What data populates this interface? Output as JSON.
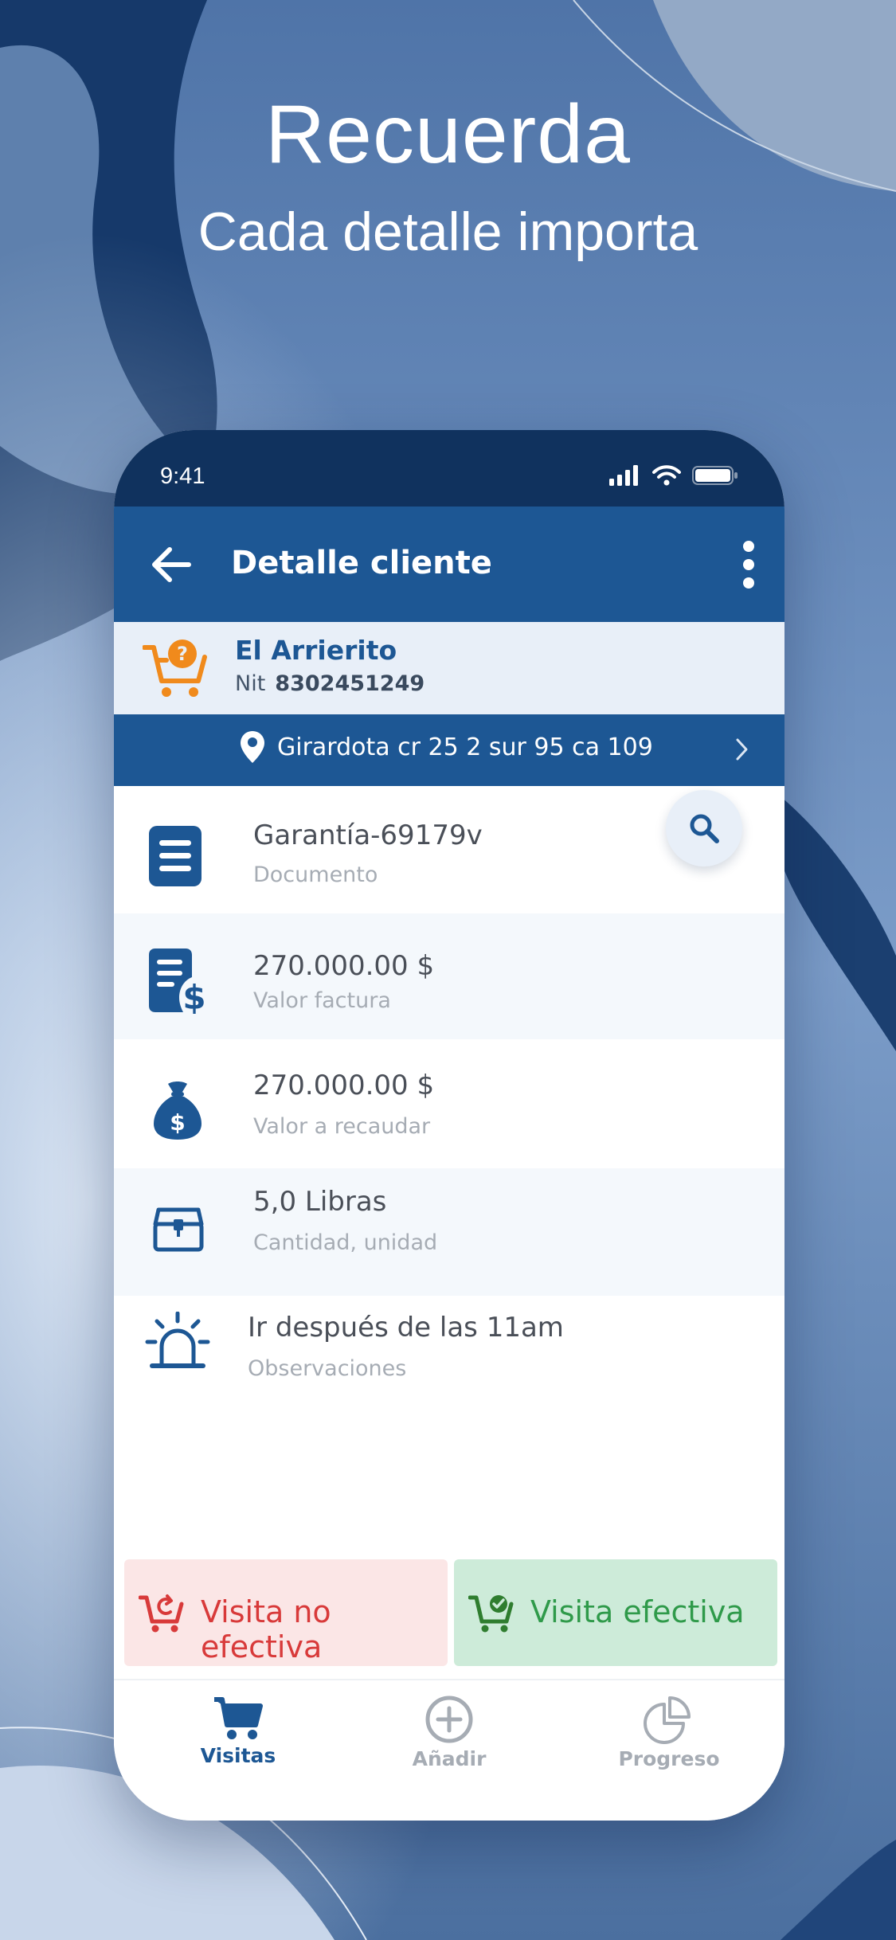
{
  "promo": {
    "headline": "Recuerda",
    "subheadline": "Cada detalle importa"
  },
  "status_bar": {
    "time": "9:41"
  },
  "app_bar": {
    "title": "Detalle cliente"
  },
  "client": {
    "name": "El Arrierito",
    "nit_label": "Nit",
    "nit_value": "8302451249"
  },
  "address": {
    "text": "Girardota cr 25 2 sur 95 ca 109"
  },
  "details": [
    {
      "value": "Garantía-69179v",
      "label": "Documento",
      "icon": "document-icon"
    },
    {
      "value": "270.000.00 $",
      "label": "Valor factura",
      "icon": "invoice-dollar-icon"
    },
    {
      "value": "270.000.00 $",
      "label": "Valor a recaudar",
      "icon": "money-bag-icon"
    },
    {
      "value": "5,0 Libras",
      "label": "Cantidad, unidad",
      "icon": "package-box-icon"
    },
    {
      "value": "Ir después de las 11am",
      "label": "Observaciones",
      "icon": "alarm-light-icon"
    }
  ],
  "actions": {
    "not_effective": "Visita no efectiva",
    "effective": "Visita efectiva"
  },
  "bottom_nav": [
    {
      "label": "Visitas",
      "active": true
    },
    {
      "label": "Añadir",
      "active": false
    },
    {
      "label": "Progreso",
      "active": false
    }
  ],
  "colors": {
    "primary": "#1d5794",
    "status_bar": "#10325e",
    "accent_orange": "#f08a1c",
    "danger": "#d83a3a",
    "success": "#2f9a4a"
  }
}
